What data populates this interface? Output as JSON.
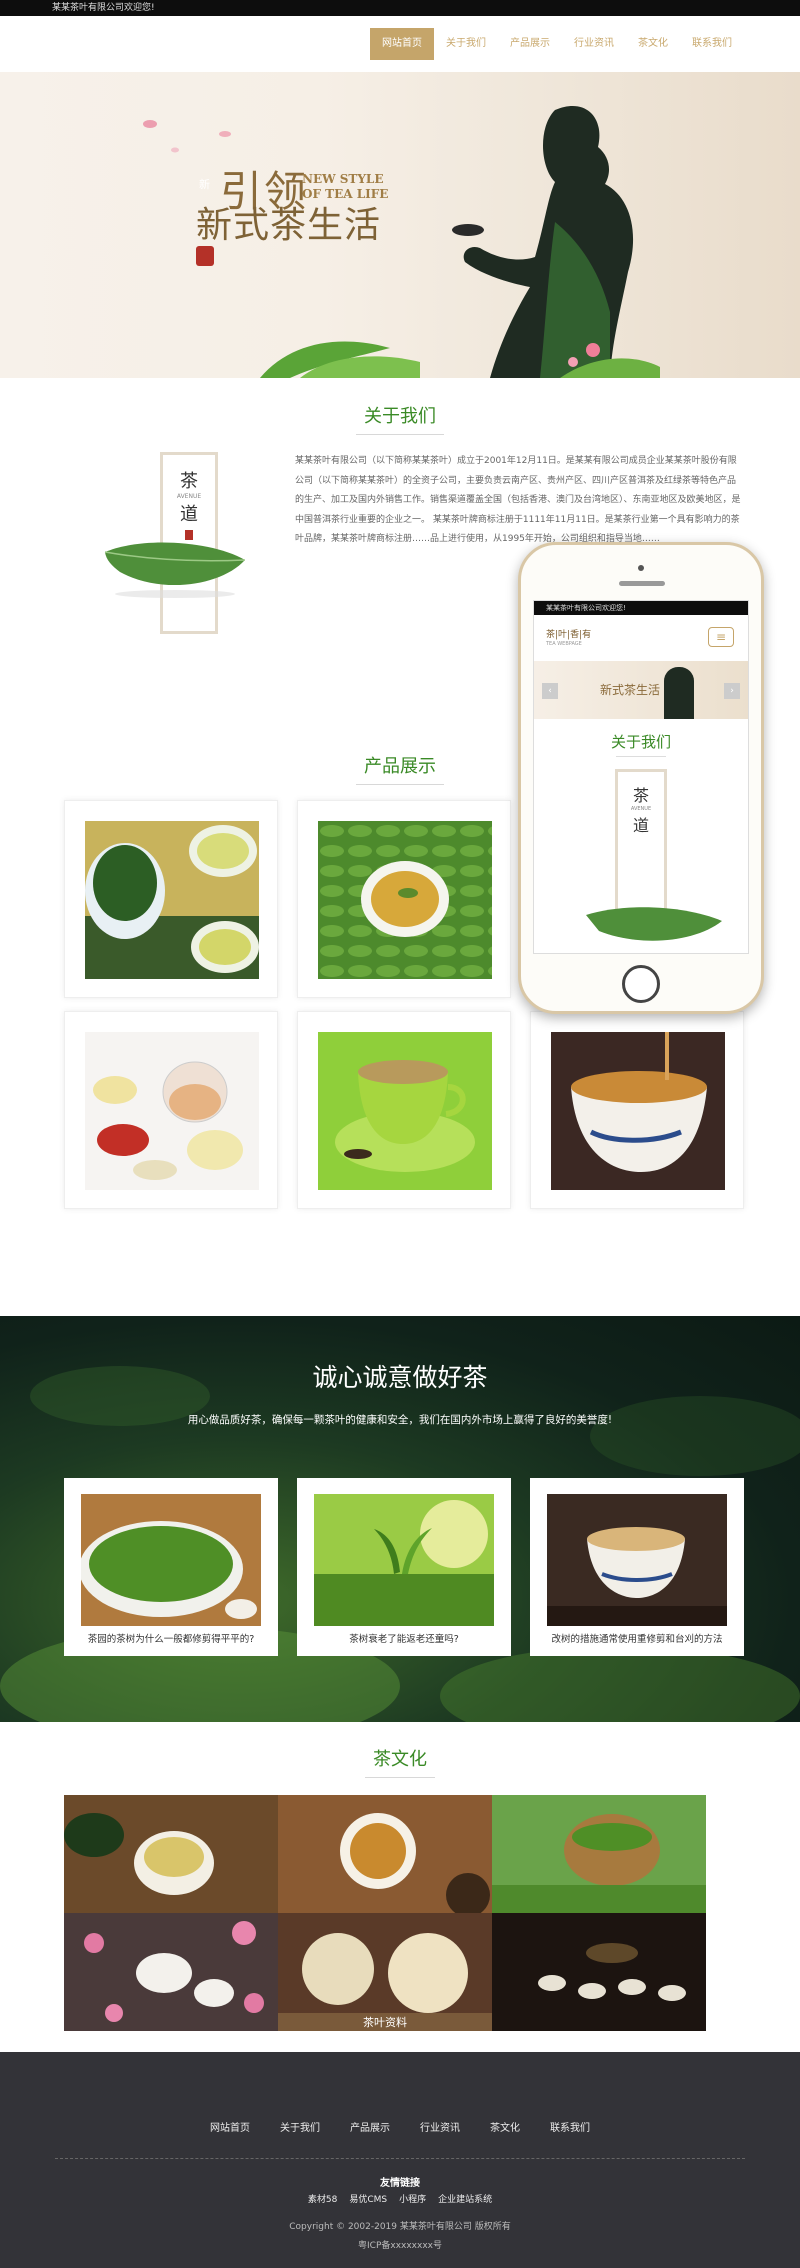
{
  "topbar": {
    "text": "某某茶叶有限公司欢迎您!"
  },
  "nav": {
    "items": [
      "网站首页",
      "关于我们",
      "产品展示",
      "行业资讯",
      "茶文化",
      "联系我们"
    ]
  },
  "banner": {
    "cn_line1": "引领",
    "cn_line2": "新式茶生活",
    "en_line1": "NEW STYLE",
    "en_line2": "OF TEA LIFE",
    "seal": "新"
  },
  "about": {
    "title": "关于我们",
    "logo_char1": "茶",
    "logo_char2": "道",
    "logo_en": "AVENUE",
    "text": "某某茶叶有限公司（以下简称某某茶叶）成立于2001年12月11日。是某某有限公司成员企业某某茶叶股份有限公司（以下简称某某茶叶）的全资子公司，主要负责云南产区、贵州产区、四川产区普洱茶及红绿茶等特色产品的生产、加工及国内外销售工作。销售渠道覆盖全国（包括香港、澳门及台湾地区）、东南亚地区及欧美地区，是中国普洱茶行业重要的企业之一。 某某茶叶牌商标注册于1111年11月11日。是某茶行业第一个具有影响力的茶叶品牌，某某茶叶牌商标注册……品上进行使用，从1995年开始，公司组织和指导当地……"
  },
  "phone": {
    "welcome": "某某茶叶有限公司欢迎您!",
    "logo": "茶|叶|香|有",
    "logo_sub": "TEA WEBPAGE",
    "about_title": "关于我们"
  },
  "products": {
    "title": "产品展示"
  },
  "dark": {
    "title": "诚心诚意做好茶",
    "subtitle": "用心做品质好茶，确保每一颗茶叶的健康和安全，我们在国内外市场上赢得了良好的美誉度!",
    "news": [
      "茶园的茶树为什么一般都修剪得平平的?",
      "茶树衰老了能返老还童吗?",
      "改树的措施通常使用重修剪和台刈的方法"
    ]
  },
  "culture": {
    "title": "茶文化",
    "watermark": "茶叶资料"
  },
  "footer": {
    "nav": [
      "网站首页",
      "关于我们",
      "产品展示",
      "行业资讯",
      "茶文化",
      "联系我们"
    ],
    "links_title": "友情链接",
    "links": [
      "素材58",
      "易优CMS",
      "小程序",
      "企业建站系统"
    ],
    "copyright": "Copyright © 2002-2019 某某茶叶有限公司 版权所有",
    "icp": "粤ICP备xxxxxxxx号"
  }
}
